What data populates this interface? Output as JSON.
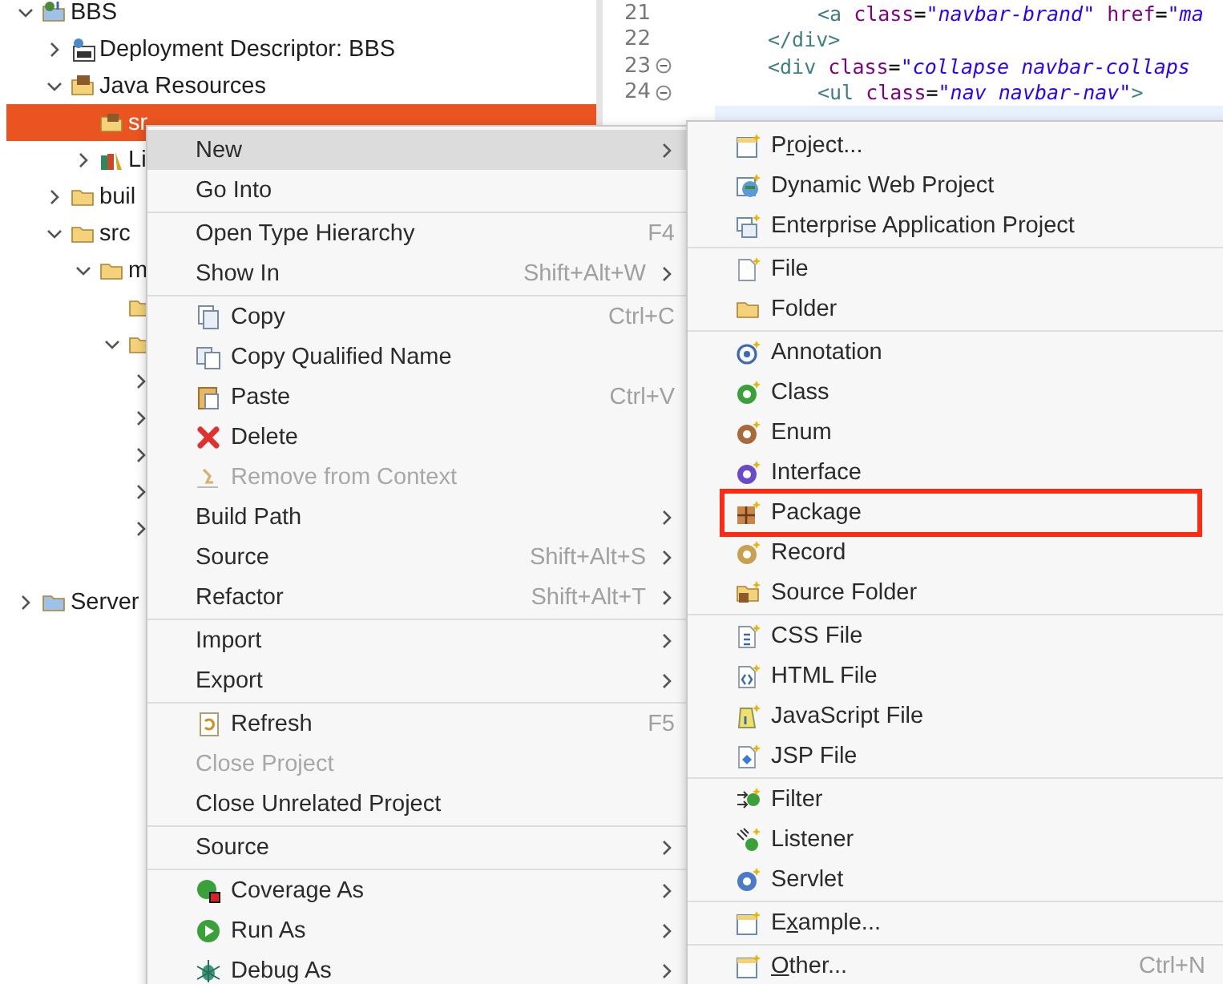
{
  "tree": [
    {
      "label": "BBS",
      "expanded": true,
      "selected": false,
      "children": [
        {
          "label": "Deployment Descriptor: BBS",
          "expanded": false,
          "selected": false
        },
        {
          "label": "Java Resources",
          "expanded": true,
          "selected": false,
          "children": [
            {
              "label": "sr",
              "selected": true
            },
            {
              "label": "Li",
              "expanded": false,
              "selected": false
            }
          ]
        },
        {
          "label": "buil",
          "expanded": false,
          "selected": false
        },
        {
          "label": "src",
          "expanded": true,
          "selected": false,
          "children": [
            {
              "label": "m",
              "expanded": true,
              "selected": false,
              "children": [
                {
                  "selected": false
                },
                {
                  "expanded": true,
                  "selected": false,
                  "children": [
                    {
                      "expanded": false,
                      "selected": false
                    },
                    {
                      "expanded": false,
                      "selected": false
                    },
                    {
                      "expanded": false,
                      "selected": false
                    },
                    {
                      "expanded": false,
                      "selected": false
                    },
                    {
                      "expanded": false,
                      "selected": false
                    }
                  ]
                }
              ]
            }
          ]
        }
      ]
    },
    {
      "label": "Server",
      "expanded": false,
      "selected": false
    }
  ],
  "editor": {
    "lines": [
      {
        "number": "21",
        "fold": false,
        "tokens": [
          {
            "kind": "tag",
            "text": "<a "
          },
          {
            "kind": "attr",
            "text": "class"
          },
          {
            "kind": "plain",
            "text": "="
          },
          {
            "kind": "value",
            "text": "\"navbar-brand\" "
          },
          {
            "kind": "attr",
            "text": "href"
          },
          {
            "kind": "plain",
            "text": "="
          },
          {
            "kind": "value",
            "text": "\"ma"
          }
        ]
      },
      {
        "number": "22",
        "fold": false,
        "tokens": [
          {
            "kind": "tag",
            "text": "</div>"
          }
        ]
      },
      {
        "number": "23",
        "fold": true,
        "tokens": [
          {
            "kind": "tag",
            "text": "<div "
          },
          {
            "kind": "attr",
            "text": "class"
          },
          {
            "kind": "plain",
            "text": "="
          },
          {
            "kind": "value",
            "text": "\"collapse navbar-collaps"
          }
        ]
      },
      {
        "number": "24",
        "fold": true,
        "tokens": [
          {
            "kind": "tag",
            "text": "<ul "
          },
          {
            "kind": "attr",
            "text": "class"
          },
          {
            "kind": "plain",
            "text": "="
          },
          {
            "kind": "value",
            "text": "\"nav navbar-nav\""
          },
          {
            "kind": "tag",
            "text": ">"
          }
        ]
      }
    ]
  },
  "context_menu": {
    "groups": [
      [
        {
          "label": "New",
          "submenu": true,
          "selected": true,
          "disabled": false
        },
        {
          "label": "Go Into",
          "submenu": false,
          "selected": false,
          "disabled": false
        }
      ],
      [
        {
          "label": "Open Type Hierarchy",
          "shortcut": "F4",
          "submenu": false,
          "selected": false,
          "disabled": false
        },
        {
          "label": "Show In",
          "shortcut": "Shift+Alt+W",
          "submenu": true,
          "selected": false,
          "disabled": false
        }
      ],
      [
        {
          "label": "Copy",
          "shortcut": "Ctrl+C",
          "submenu": false,
          "selected": false,
          "disabled": false
        },
        {
          "label": "Copy Qualified Name",
          "submenu": false,
          "selected": false,
          "disabled": false
        },
        {
          "label": "Paste",
          "shortcut": "Ctrl+V",
          "submenu": false,
          "selected": false,
          "disabled": false
        },
        {
          "label": "Delete",
          "submenu": false,
          "selected": false,
          "disabled": false
        },
        {
          "label": "Remove from Context",
          "submenu": false,
          "selected": false,
          "disabled": true
        },
        {
          "label": "Build Path",
          "submenu": true,
          "selected": false,
          "disabled": false
        },
        {
          "label": "Source",
          "shortcut": "Shift+Alt+S",
          "submenu": true,
          "selected": false,
          "disabled": false
        },
        {
          "label": "Refactor",
          "shortcut": "Shift+Alt+T",
          "submenu": true,
          "selected": false,
          "disabled": false
        }
      ],
      [
        {
          "label": "Import",
          "submenu": true,
          "selected": false,
          "disabled": false
        },
        {
          "label": "Export",
          "submenu": true,
          "selected": false,
          "disabled": false
        }
      ],
      [
        {
          "label": "Refresh",
          "shortcut": "F5",
          "submenu": false,
          "selected": false,
          "disabled": false
        },
        {
          "label": "Close Project",
          "submenu": false,
          "selected": false,
          "disabled": true
        },
        {
          "label": "Close Unrelated Project",
          "submenu": false,
          "selected": false,
          "disabled": false
        }
      ],
      [
        {
          "label": "Source",
          "submenu": true,
          "selected": false,
          "disabled": false
        }
      ],
      [
        {
          "label": "Coverage As",
          "submenu": true,
          "selected": false,
          "disabled": false
        },
        {
          "label": "Run As",
          "submenu": true,
          "selected": false,
          "disabled": false
        },
        {
          "label": "Debug As",
          "submenu": true,
          "selected": false,
          "disabled": false
        }
      ]
    ]
  },
  "submenu": {
    "groups": [
      [
        {
          "label": "Project...",
          "highlighted": false
        },
        {
          "label": "Dynamic Web Project",
          "highlighted": false
        },
        {
          "label": "Enterprise Application Project",
          "highlighted": false
        }
      ],
      [
        {
          "label": "File",
          "highlighted": false
        },
        {
          "label": "Folder",
          "highlighted": false
        }
      ],
      [
        {
          "label": "Annotation",
          "highlighted": false
        },
        {
          "label": "Class",
          "highlighted": false
        },
        {
          "label": "Enum",
          "highlighted": false
        },
        {
          "label": "Interface",
          "highlighted": false
        },
        {
          "label": "Package",
          "highlighted": true
        },
        {
          "label": "Record",
          "highlighted": false
        },
        {
          "label": "Source Folder",
          "highlighted": false
        }
      ],
      [
        {
          "label": "CSS File",
          "highlighted": false
        },
        {
          "label": "HTML File",
          "highlighted": false
        },
        {
          "label": "JavaScript File",
          "highlighted": false
        },
        {
          "label": "JSP File",
          "highlighted": false
        }
      ],
      [
        {
          "label": "Filter",
          "highlighted": false
        },
        {
          "label": "Listener",
          "highlighted": false
        },
        {
          "label": "Servlet",
          "highlighted": false
        }
      ],
      [
        {
          "label": "Example...",
          "highlighted": false
        }
      ],
      [
        {
          "label": "Other...",
          "shortcut": "Ctrl+N",
          "highlighted": false
        }
      ]
    ]
  }
}
